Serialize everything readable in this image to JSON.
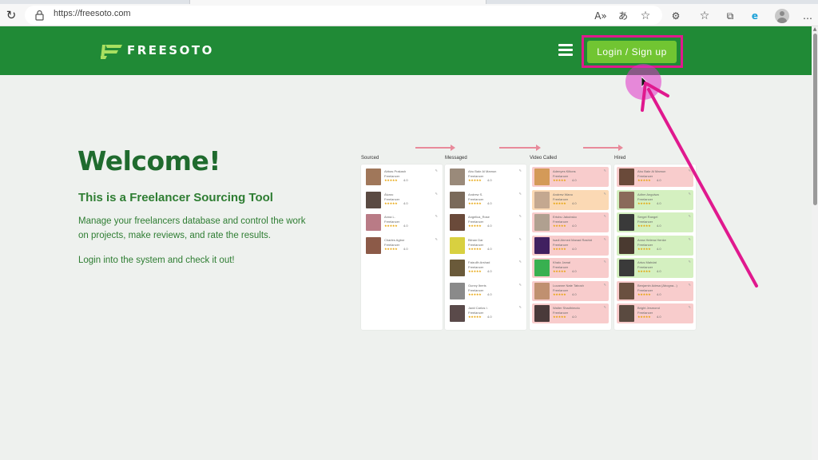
{
  "browser": {
    "url": "https://freesoto.com",
    "toolbar_icons": [
      "reload-icon",
      "lock-icon",
      "read-aloud-icon",
      "translate-icon",
      "favorite-star-icon",
      "extensions-icon",
      "favorites-icon",
      "collections-icon",
      "copilot-icon",
      "profile-avatar",
      "more-icon"
    ],
    "glyph_reload": "↻",
    "glyph_read_aloud": "A»",
    "glyph_translate": "あ",
    "glyph_star": "☆",
    "glyph_ext": "⚙",
    "glyph_favs": "☆",
    "glyph_collections": "⧉",
    "glyph_edge": "e",
    "glyph_more": "…"
  },
  "header": {
    "logo_text": "FREESOTO",
    "login_label": "Login / Sign up",
    "color_bg": "#208a36",
    "color_button": "#71c532",
    "color_highlight": "#e0198e"
  },
  "hero": {
    "title": "Welcome!",
    "subtitle": "This is a Freelancer Sourcing Tool",
    "description": "Manage your freelancers database and control the work on projects, make reviews, and rate the results.",
    "cta": "Login into the system and check it out!"
  },
  "kanban": {
    "columns": [
      {
        "title": "Sourced",
        "cards": [
          {
            "name": "Abbas Prakash",
            "role": "Freelancer",
            "stars": "★★★★★",
            "rating": "4.0",
            "color": "#ffffff",
            "photo": "#a0775a"
          },
          {
            "name": "Álvaro",
            "role": "Freelancer",
            "stars": "★★★★★",
            "rating": "4.0",
            "color": "#ffffff",
            "photo": "#5a4a42"
          },
          {
            "name": "Anna L.",
            "role": "Freelancer",
            "stars": "★★★★★",
            "rating": "4.0",
            "color": "#ffffff",
            "photo": "#b97b86"
          },
          {
            "name": "Charles Agbor",
            "role": "Freelancer",
            "stars": "★★★★★",
            "rating": "4.0",
            "color": "#ffffff",
            "photo": "#8c5a48"
          }
        ]
      },
      {
        "title": "Messaged",
        "cards": [
          {
            "name": "Abu Bakr Al Mamun",
            "role": "Freelancer",
            "stars": "★★★★★",
            "rating": "4.0",
            "color": "#ffffff",
            "photo": "#9a8a7a"
          },
          {
            "name": "Andrew S.",
            "role": "Freelancer",
            "stars": "★★★★★",
            "rating": "4.0",
            "color": "#ffffff",
            "photo": "#7a6a5a"
          },
          {
            "name": "Angelica_Rose",
            "role": "Freelancer",
            "stars": "★★★★★",
            "rating": "4.0",
            "color": "#ffffff",
            "photo": "#6a4a3a"
          },
          {
            "name": "Bilnan Dar",
            "role": "Freelancer",
            "stars": "★★★★★",
            "rating": "4.0",
            "color": "#ffffff",
            "photo": "#d8d040"
          },
          {
            "name": "Faizullh Arshad",
            "role": "Freelancer",
            "stars": "★★★★★",
            "rating": "4.0",
            "color": "#ffffff",
            "photo": "#6a5a3a"
          },
          {
            "name": "Gunny Iberis",
            "role": "Freelancer",
            "stars": "★★★★★",
            "rating": "4.0",
            "color": "#ffffff",
            "photo": "#8a8a8a"
          },
          {
            "name": "Jadd Carlos I.",
            "role": "Freelancer",
            "stars": "★★★★★",
            "rating": "4.0",
            "color": "#ffffff",
            "photo": "#5a4a4a"
          }
        ]
      },
      {
        "title": "Video Called",
        "cards": [
          {
            "name": "Adenyes Kiltons",
            "role": "Freelancer",
            "stars": "★★★★★",
            "rating": "4.0",
            "color": "#f8cccc",
            "photo": "#d49a58"
          },
          {
            "name": "Andrew Wano",
            "role": "Freelancer",
            "stars": "★★★★★",
            "rating": "4.0",
            "color": "#fbd9b4",
            "photo": "#c4a890"
          },
          {
            "name": "Ertobu Jakubsko",
            "role": "Freelancer",
            "stars": "★★★★★",
            "rating": "4.0",
            "color": "#f8cccc",
            "photo": "#b0a090"
          },
          {
            "name": "Isadi Ahmed Manad Rashid",
            "role": "Freelancer",
            "stars": "★★★★★",
            "rating": "4.0",
            "color": "#f8cccc",
            "photo": "#402060"
          },
          {
            "name": "Khalo Jamal",
            "role": "Freelancer",
            "stars": "★★★★★",
            "rating": "4.0",
            "color": "#f8cccc",
            "photo": "#38b050"
          },
          {
            "name": "Lucanne Nate Tabosh",
            "role": "Freelancer",
            "stars": "★★★★★",
            "rating": "4.0",
            "color": "#f8cccc",
            "photo": "#c09070"
          },
          {
            "name": "Walter Shadhimoto",
            "role": "Freelancer",
            "stars": "★★★★★",
            "rating": "4.0",
            "color": "#f8cccc",
            "photo": "#4a3a3a"
          }
        ]
      },
      {
        "title": "Hired",
        "cards": [
          {
            "name": "Abu Bakr Al Mamun",
            "role": "Freelancer",
            "stars": "★★★★★",
            "rating": "4.0",
            "color": "#f8cccc",
            "photo": "#6a4a3a"
          },
          {
            "name": "Adhm Angulwa",
            "role": "Freelancer",
            "stars": "★★★★★",
            "rating": "4.0",
            "color": "#d4f0c0",
            "photo": "#8a6a5a"
          },
          {
            "name": "Sergei Rangel",
            "role": "Freelancer",
            "stars": "★★★★★",
            "rating": "4.0",
            "color": "#d4f0c0",
            "photo": "#3a3a3a"
          },
          {
            "name": "Anna Helena Henke",
            "role": "Freelancer",
            "stars": "★★★★★",
            "rating": "4.0",
            "color": "#d4f0c0",
            "photo": "#4a3a30"
          },
          {
            "name": "Artus Mahdat",
            "role": "Freelancer",
            "stars": "★★★★★",
            "rating": "4.0",
            "color": "#d4f0c0",
            "photo": "#3a3a3a"
          },
          {
            "name": "Benjamin Adesa (Abogna...)",
            "role": "Freelancer",
            "stars": "★★★★★",
            "rating": "4.0",
            "color": "#f8cccc",
            "photo": "#6a5040"
          },
          {
            "name": "Bright Jesmond",
            "role": "Freelancer",
            "stars": "★★★★★",
            "rating": "4.0",
            "color": "#f8cccc",
            "photo": "#5a4a40"
          }
        ]
      }
    ]
  }
}
